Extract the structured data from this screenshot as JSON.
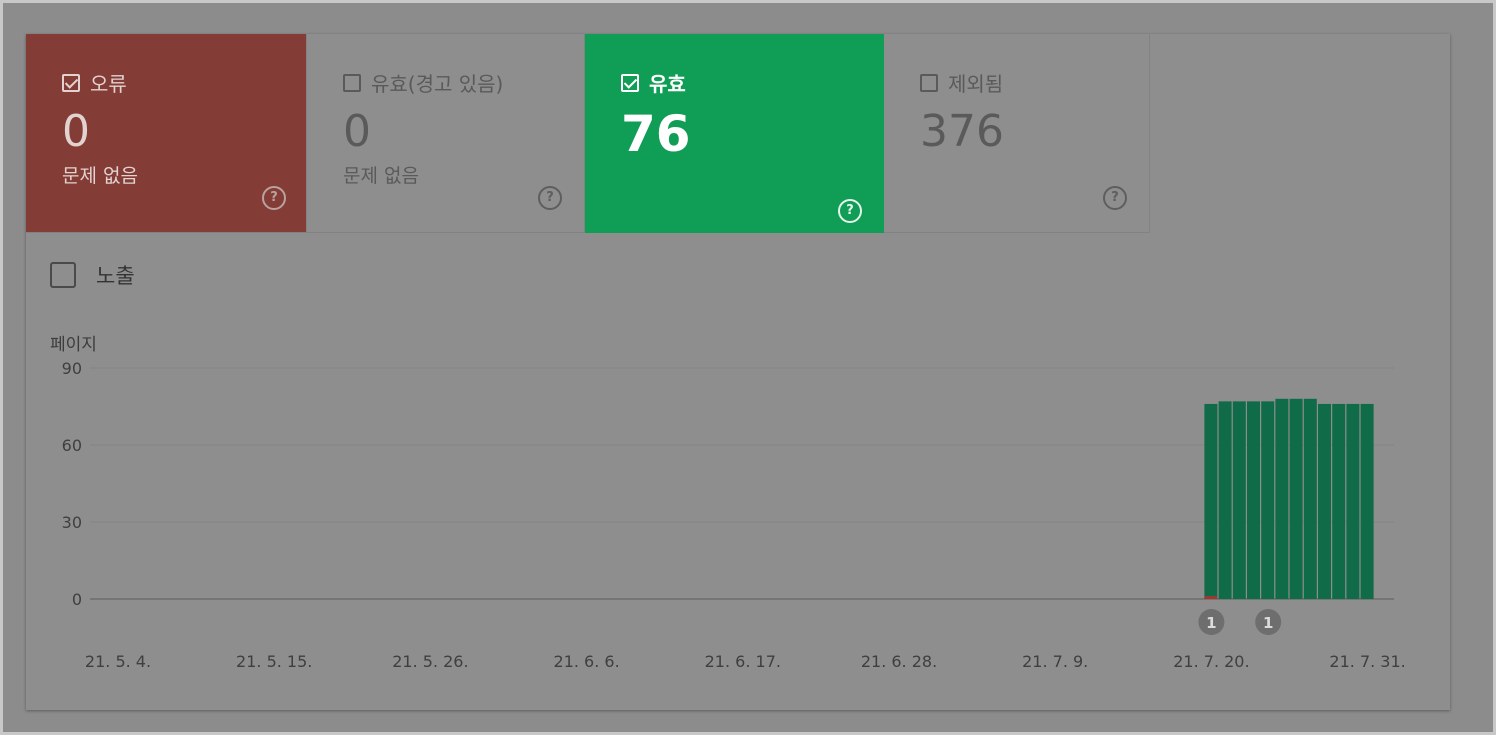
{
  "tiles": [
    {
      "label": "오류",
      "checked": true,
      "value": "0",
      "sub": "문제 없음",
      "help": "?",
      "color": "#843c36"
    },
    {
      "label": "유효(경고 있음)",
      "checked": false,
      "value": "0",
      "sub": "문제 없음",
      "help": "?",
      "color": "#8e8e8e"
    },
    {
      "label": "유효",
      "checked": true,
      "value": "76",
      "sub": "",
      "help": "?",
      "color": "#109d56"
    },
    {
      "label": "제외됨",
      "checked": false,
      "value": "376",
      "sub": "",
      "help": "?",
      "color": "#8e8e8e"
    }
  ],
  "impressions_label": "노출",
  "chart_data": {
    "type": "bar",
    "ylabel": "페이지",
    "ylim": [
      0,
      90
    ],
    "yticks": [
      "90",
      "60",
      "30",
      "0"
    ],
    "x_tick_labels": [
      "21. 5. 4.",
      "21. 5. 15.",
      "21. 5. 26.",
      "21. 6. 6.",
      "21. 6. 17.",
      "21. 6. 28.",
      "21. 7. 9.",
      "21. 7. 20.",
      "21. 7. 31."
    ],
    "x_start": "21. 5. 4.",
    "days_total": 88,
    "series": [
      {
        "name": "유효",
        "color": "#0f6b48",
        "x_dates": [
          "21. 7. 20.",
          "21. 7. 21.",
          "21. 7. 22.",
          "21. 7. 23.",
          "21. 7. 24.",
          "21. 7. 25.",
          "21. 7. 26.",
          "21. 7. 27.",
          "21. 7. 28.",
          "21. 7. 29.",
          "21. 7. 30.",
          "21. 7. 31."
        ],
        "values": [
          76,
          77,
          77,
          77,
          77,
          78,
          78,
          78,
          76,
          76,
          76,
          76
        ]
      }
    ],
    "annotations": [
      {
        "x_date": "21. 7. 20.",
        "label": "1"
      },
      {
        "x_date": "21. 7. 24.",
        "label": "1"
      }
    ],
    "grid": true
  }
}
